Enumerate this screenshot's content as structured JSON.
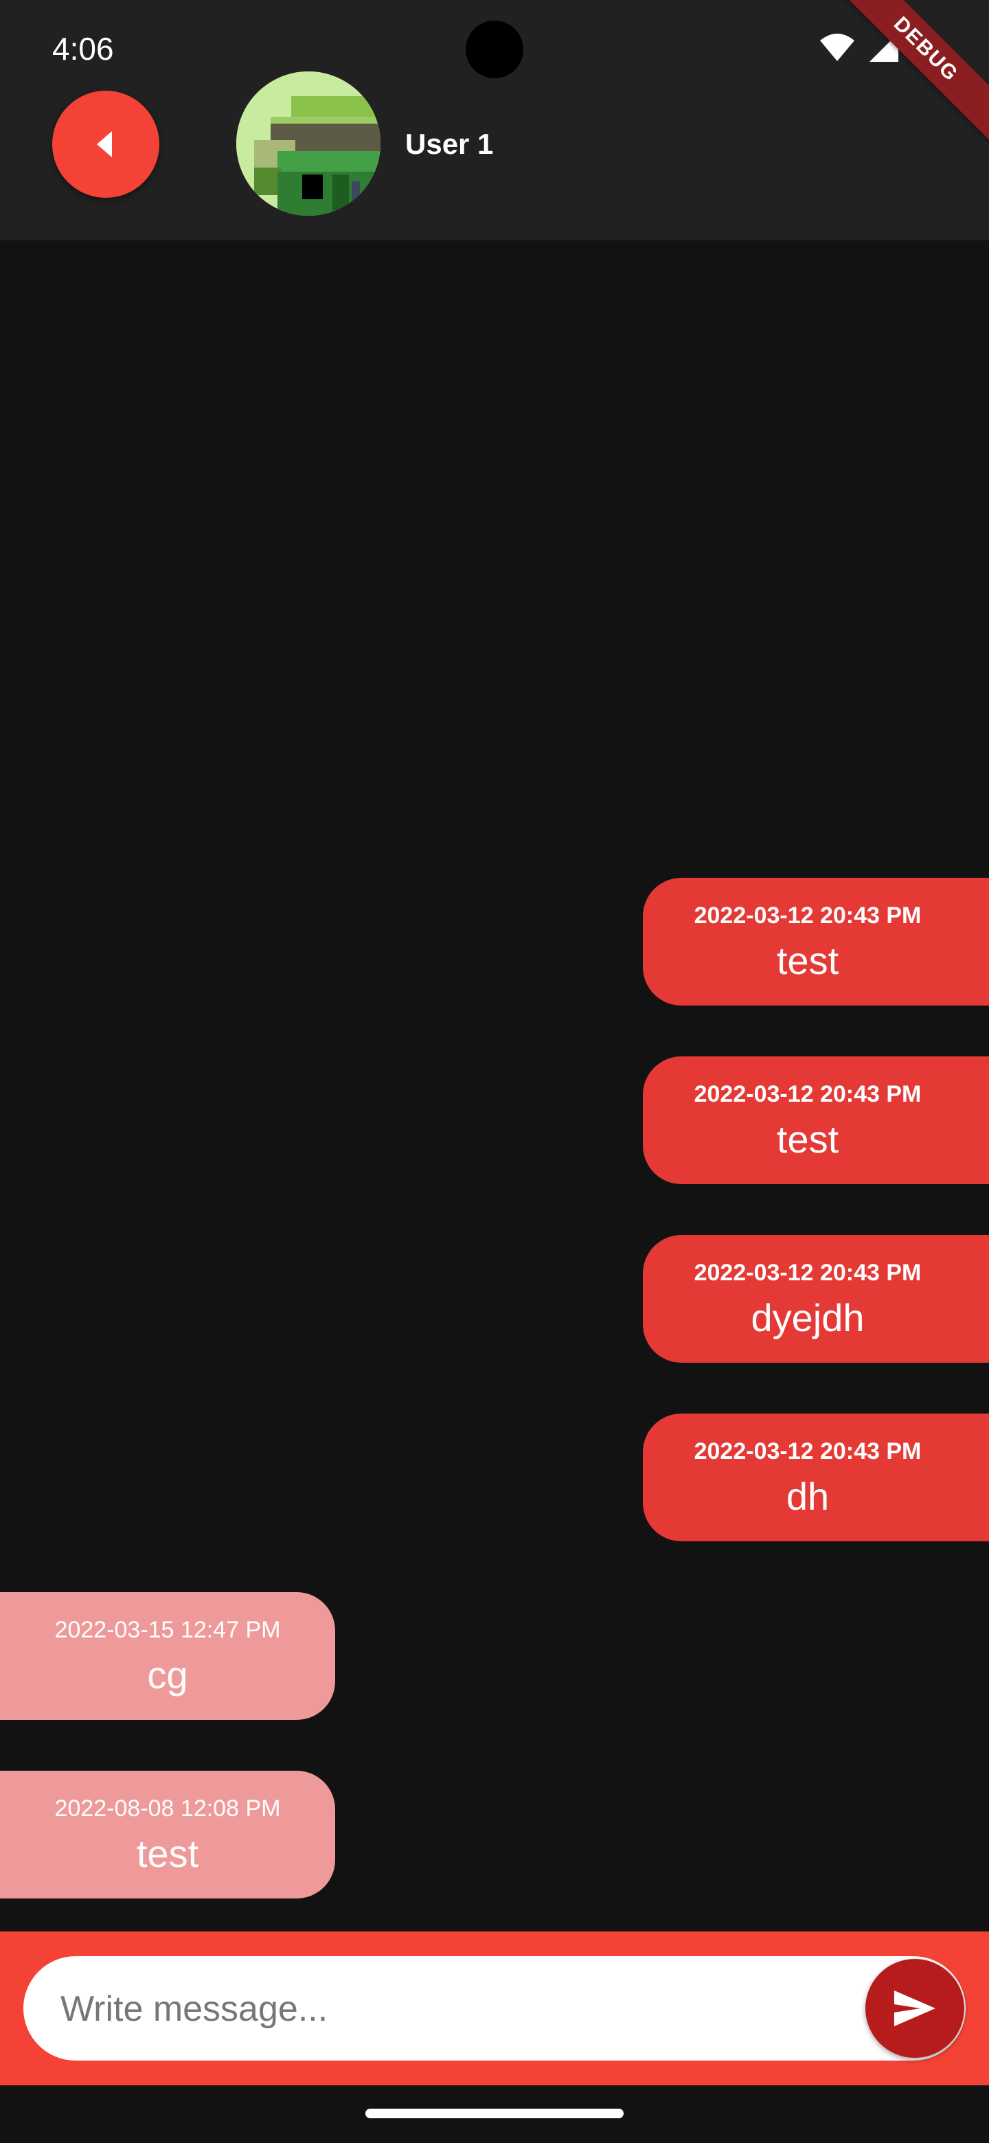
{
  "status_bar": {
    "time": "4:06"
  },
  "debug_banner": "DEBUG",
  "header": {
    "back_icon": "caret-left-icon",
    "user_name": "User 1",
    "accent": "#f44336"
  },
  "messages": [
    {
      "direction": "sent",
      "timestamp": "2022-03-12 20:43 PM",
      "text": "test"
    },
    {
      "direction": "sent",
      "timestamp": "2022-03-12 20:43 PM",
      "text": "test"
    },
    {
      "direction": "sent",
      "timestamp": "2022-03-12 20:43 PM",
      "text": "dyejdh"
    },
    {
      "direction": "sent",
      "timestamp": "2022-03-12 20:43 PM",
      "text": "dh"
    },
    {
      "direction": "received",
      "timestamp": "2022-03-15 12:47 PM",
      "text": "cg"
    },
    {
      "direction": "received",
      "timestamp": "2022-08-08 12:08 PM",
      "text": "test"
    }
  ],
  "composer": {
    "placeholder": "Write message...",
    "value": "",
    "send_icon": "send-icon"
  },
  "colors": {
    "sent_bubble": "#e53935",
    "received_bubble": "#ef9a9a",
    "background": "#121212",
    "app_bar": "#212121"
  }
}
